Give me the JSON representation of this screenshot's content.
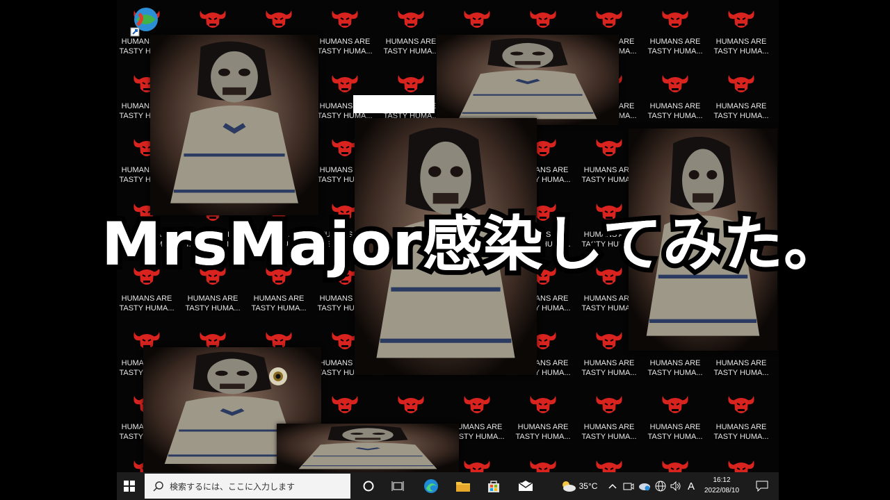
{
  "headline": "MrsMajor感染してみた。",
  "desktop": {
    "icon_label": "HUMANS ARE\nTASTY HUMA...",
    "icon_name": "red-demon-icon",
    "popup_image": "creepy-doll-photo"
  },
  "taskbar": {
    "search_placeholder": "検索するには、ここに入力します",
    "weather_temp": "35°C",
    "ime_label": "A",
    "time": "16:12",
    "date": "2022/08/10"
  },
  "colors": {
    "demon_red": "#d8231f",
    "taskbar": "#1c1c1c",
    "search_box": "#f3f3f3"
  }
}
